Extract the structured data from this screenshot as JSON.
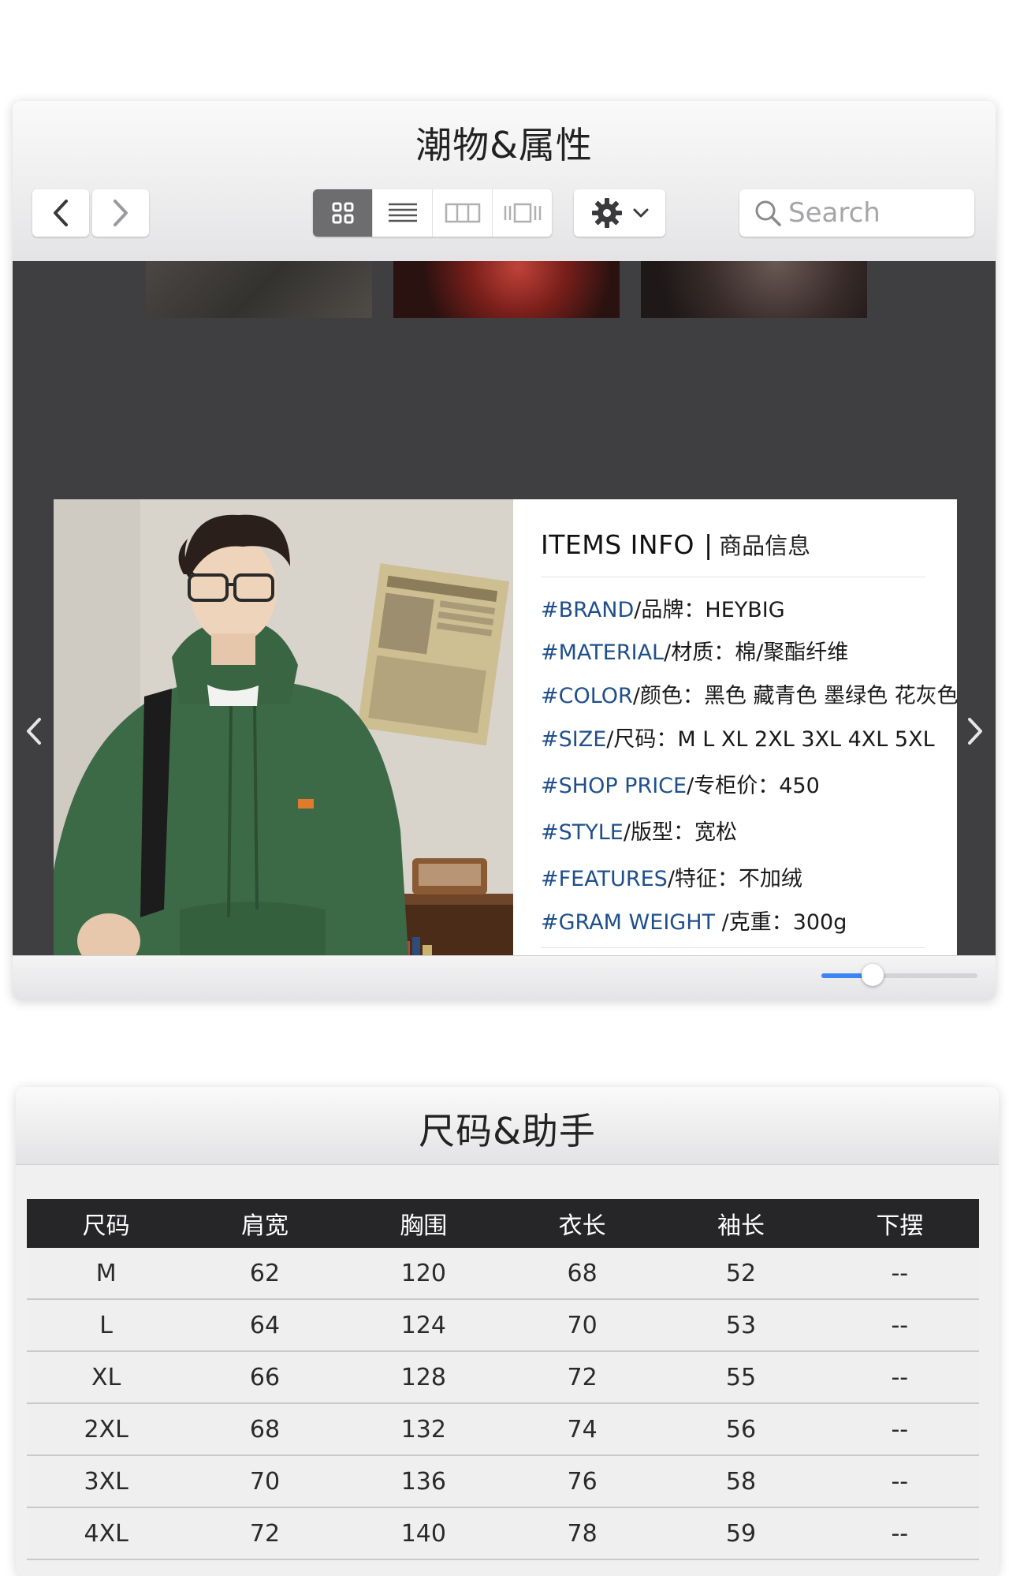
{
  "window1": {
    "title": "潮物&属性",
    "search_placeholder": "Search",
    "view_modes": [
      "icon-view",
      "list-view",
      "column-view",
      "gallery-view"
    ],
    "active_view": "icon-view",
    "zoom_slider_value": 0.25
  },
  "item_card": {
    "heading_en": "ITEMS INFO",
    "heading_sep": "|",
    "heading_cn": "商品信息",
    "attributes": [
      {
        "key": "#BRAND",
        "label": "/品牌：",
        "value": "HEYBIG"
      },
      {
        "key": "#MATERIAL",
        "label": "/材质：",
        "value": "棉/聚酯纤维"
      },
      {
        "key": "#COLOR",
        "label": "/颜色：",
        "value": "黑色 藏青色 墨绿色 花灰色"
      },
      {
        "key": "#SIZE",
        "label": "/尺码：",
        "value": "M L XL 2XL 3XL 4XL 5XL"
      },
      {
        "key": "#SHOP PRICE",
        "label": "/专柜价：",
        "value": "450"
      },
      {
        "key": "#STYLE",
        "label": "/版型：",
        "value": "宽松"
      },
      {
        "key": "#FEATURES",
        "label": "/特征：",
        "value": "不加绒"
      },
      {
        "key": "#GRAM WEIGHT",
        "label": " /克重：",
        "value": "300g"
      }
    ],
    "liked": true,
    "colors": {
      "key": "#1f4f8a",
      "heart": "#ef3340",
      "photo_hoodie": "#3d6a46"
    }
  },
  "window2": {
    "title": "尺码&助手",
    "headers": [
      "尺码",
      "肩宽",
      "胸围",
      "衣长",
      "袖长",
      "下摆"
    ],
    "rows": [
      [
        "M",
        "62",
        "120",
        "68",
        "52",
        "--"
      ],
      [
        "L",
        "64",
        "124",
        "70",
        "53",
        "--"
      ],
      [
        "XL",
        "66",
        "128",
        "72",
        "55",
        "--"
      ],
      [
        "2XL",
        "68",
        "132",
        "74",
        "56",
        "--"
      ],
      [
        "3XL",
        "70",
        "136",
        "76",
        "58",
        "--"
      ],
      [
        "4XL",
        "72",
        "140",
        "78",
        "59",
        "--"
      ]
    ]
  }
}
